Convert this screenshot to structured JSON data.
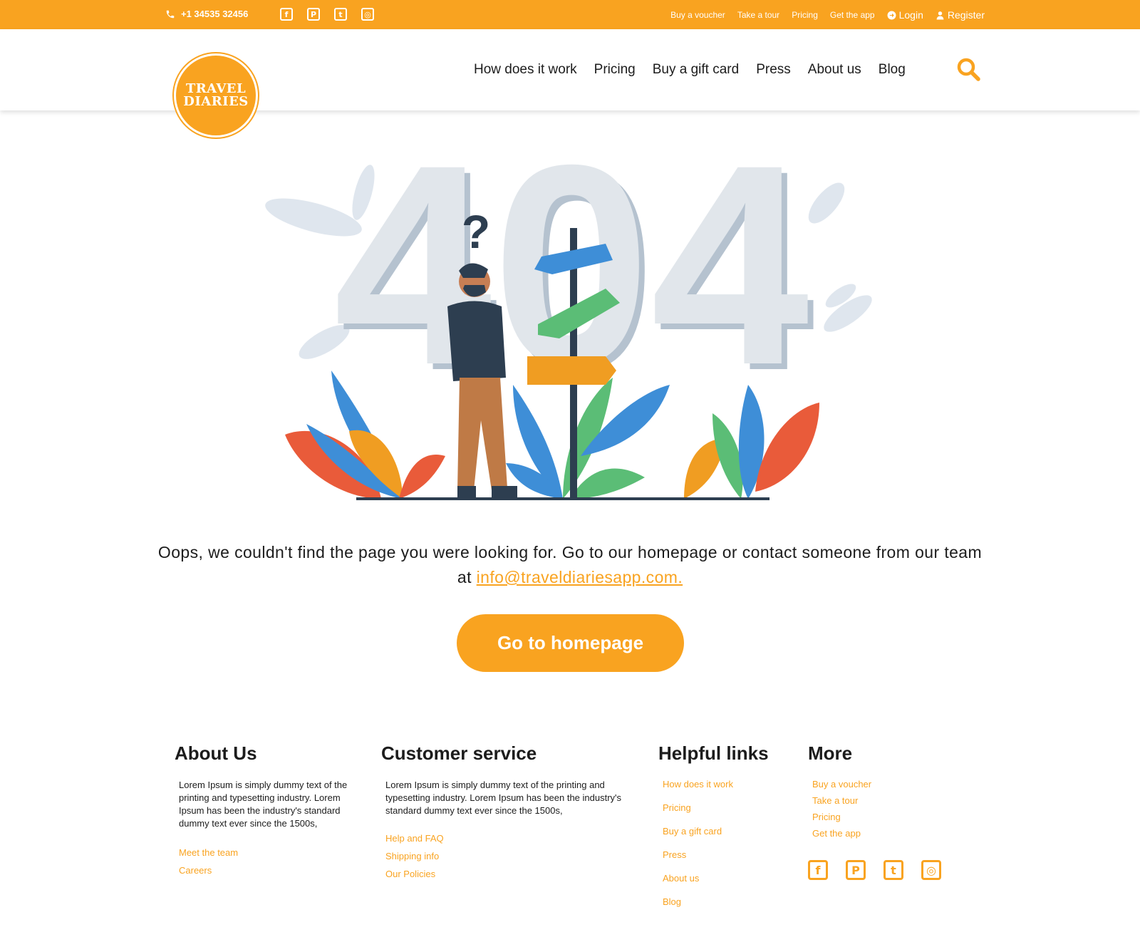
{
  "topbar": {
    "phone": "+1 34535 32456",
    "socials": [
      "facebook-icon",
      "pinterest-icon",
      "twitter-icon",
      "instagram-icon"
    ],
    "links": [
      "Buy a voucher",
      "Take a tour",
      "Pricing",
      "Get the app"
    ],
    "login": "Login",
    "register": "Register"
  },
  "logo": {
    "line1": "TRAVEL",
    "line2": "DIARIES"
  },
  "nav": [
    "How does it work",
    "Pricing",
    "Buy a gift card",
    "Press",
    "About us",
    "Blog"
  ],
  "hero": {
    "code": "404",
    "question": "?"
  },
  "message": {
    "text": "Oops, we couldn't find the page you were looking for. Go to our homepage or contact someone from our team at",
    "email": "info@traveldiariesapp.com."
  },
  "button": "Go to homepage",
  "footer": {
    "about": {
      "title": "About Us",
      "text": "Lorem Ipsum is simply dummy text of the printing and typesetting industry. Lorem Ipsum has been the industry's standard dummy text ever since the 1500s,",
      "links": [
        "Meet the team",
        "Careers"
      ]
    },
    "service": {
      "title": "Customer service",
      "text": "Lorem Ipsum is simply dummy text of the printing and typesetting industry. Lorem Ipsum has been the industry's standard dummy text ever since the 1500s,",
      "links": [
        "Help and FAQ",
        "Shipping info",
        "Our Policies"
      ]
    },
    "helpful": {
      "title": "Helpful links",
      "links": [
        "How does it work",
        "Pricing",
        "Buy a gift card",
        "Press",
        "About us",
        "Blog"
      ]
    },
    "more": {
      "title": "More",
      "links": [
        "Buy a voucher",
        "Take a tour",
        "Pricing",
        "Get the app"
      ]
    }
  },
  "colors": {
    "accent": "#f9a320",
    "text": "#1c1c1c"
  }
}
